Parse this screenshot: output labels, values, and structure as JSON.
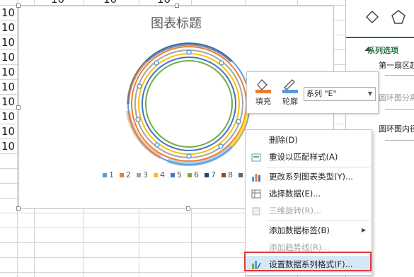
{
  "sheet": {
    "row_values": [
      "10",
      "10",
      "10",
      "10",
      "10",
      "10",
      "10",
      "10",
      "10",
      "10"
    ],
    "top_values": [
      "10",
      "10",
      "10"
    ]
  },
  "chart": {
    "title": "图表标题",
    "legend": [
      {
        "label": "1",
        "color": "#5b9bd5"
      },
      {
        "label": "2",
        "color": "#ed7d31"
      },
      {
        "label": "3",
        "color": "#a5a5a5"
      },
      {
        "label": "4",
        "color": "#ffc000"
      },
      {
        "label": "5",
        "color": "#4472c4"
      },
      {
        "label": "6",
        "color": "#70ad47"
      },
      {
        "label": "7",
        "color": "#264478"
      },
      {
        "label": "8",
        "color": "#9e480e"
      },
      {
        "label": "9",
        "color": "#636363"
      }
    ]
  },
  "mini_toolbar": {
    "fill_label": "填充",
    "outline_label": "轮廓",
    "series_value": "系列 \"E\""
  },
  "context_menu": {
    "items": [
      {
        "label": "删除(D)",
        "disabled": false
      },
      {
        "label": "重设以匹配样式(A)",
        "disabled": false
      },
      {
        "label": "更改系列图表类型(Y)...",
        "disabled": false
      },
      {
        "label": "选择数据(E)...",
        "disabled": false
      },
      {
        "label": "三维旋转(R)...",
        "disabled": true
      },
      {
        "label": "添加数据标签(B)",
        "disabled": false
      },
      {
        "label": "添加趋势线(R)...",
        "disabled": true
      },
      {
        "label": "设置数据系列格式(F)...",
        "disabled": false
      }
    ]
  },
  "pane": {
    "section": "系列选项",
    "label1": "第一扇区起",
    "label2": "圆环图分离",
    "label3": "圆环图内径"
  },
  "accent_color": "#217346",
  "highlight_color": "#e23a3a"
}
